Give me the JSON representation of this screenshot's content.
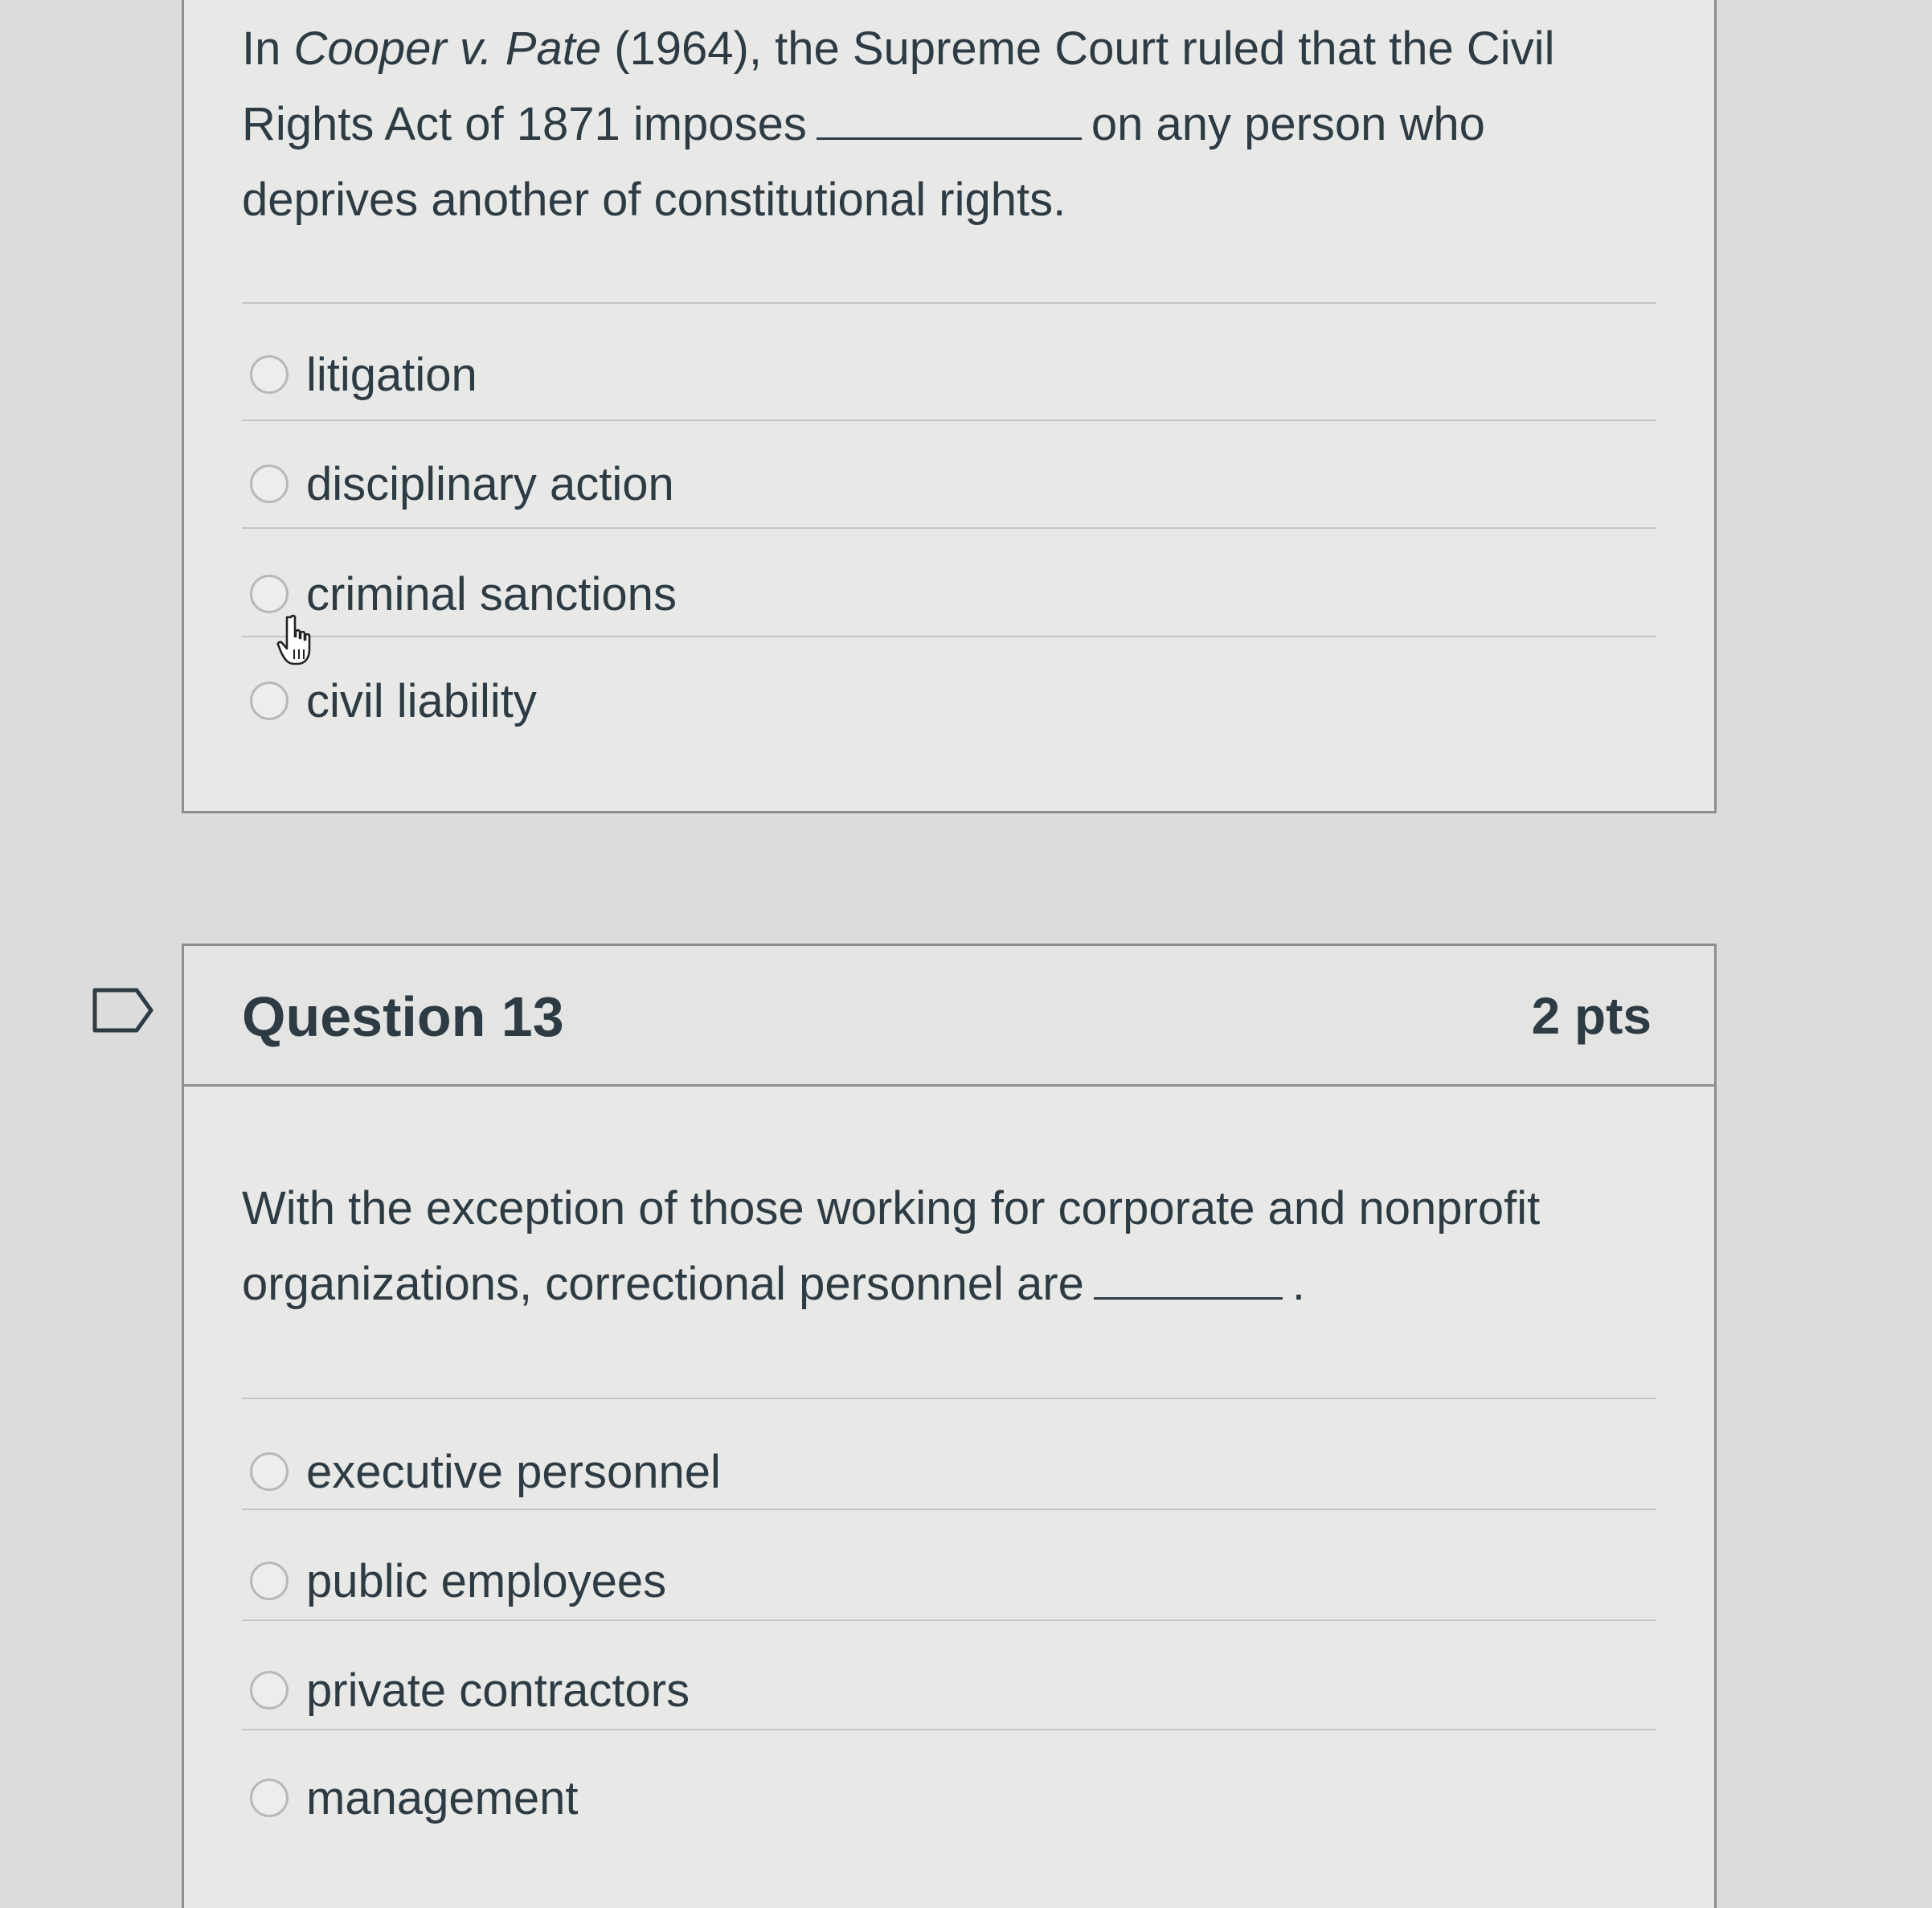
{
  "question12": {
    "text_before_italic": "In ",
    "case_name": "Cooper v. Pate",
    "text_after_case": " (1964), the Supreme Court ruled that the Civil Rights Act of 1871 imposes",
    "text_after_blank": "on any person who deprives another of constitutional rights.",
    "answers": [
      {
        "label": "litigation"
      },
      {
        "label": "disciplinary action"
      },
      {
        "label": "criminal sanctions"
      },
      {
        "label": "civil liability"
      }
    ]
  },
  "question13": {
    "title": "Question 13",
    "points": "2 pts",
    "text_before_blank": "With the exception of those working for corporate and nonprofit organizations, correctional personnel are",
    "text_after_blank": ".",
    "answers": [
      {
        "label": "executive personnel"
      },
      {
        "label": "public employees"
      },
      {
        "label": "private contractors"
      },
      {
        "label": "management"
      }
    ]
  },
  "icons": {
    "flag": "flag-question-icon",
    "cursor": "hand-pointer-cursor-icon",
    "radio": "radio-button-icon"
  },
  "colors": {
    "page_background": "#dcdcdc",
    "card_background": "#e8e8e6",
    "card_border": "#8e8e8e",
    "text": "#2d3b45"
  }
}
